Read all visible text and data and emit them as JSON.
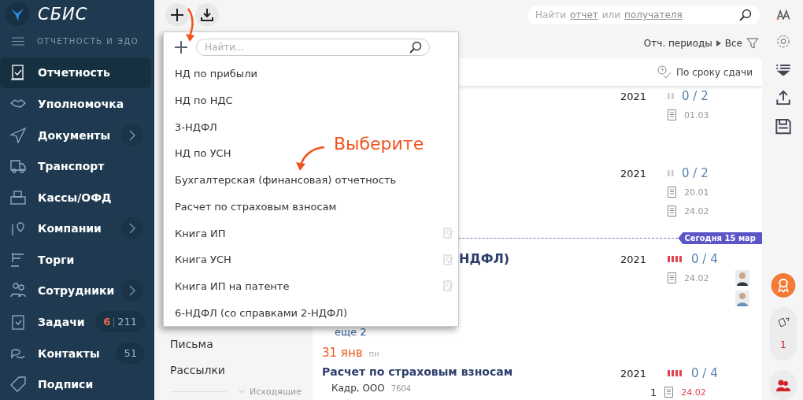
{
  "sidebar": {
    "logo": "СБИС",
    "section": "ОТЧЕТНОСТЬ И ЭДО",
    "items": [
      {
        "label": "Отчетность",
        "selected": true,
        "expandable": false
      },
      {
        "label": "Уполномочка",
        "selected": false,
        "expandable": false
      },
      {
        "label": "Документы",
        "selected": false,
        "expandable": true
      },
      {
        "label": "Транспорт",
        "selected": false,
        "expandable": false
      },
      {
        "label": "Кассы/ОФД",
        "selected": false,
        "expandable": false
      },
      {
        "label": "Компании",
        "selected": false,
        "expandable": true
      },
      {
        "label": "Торги",
        "selected": false,
        "expandable": false
      },
      {
        "label": "Сотрудники",
        "selected": false,
        "expandable": true
      },
      {
        "label": "Задачи",
        "selected": false,
        "expandable": false,
        "alert": "6",
        "count": "211"
      },
      {
        "label": "Контакты",
        "selected": false,
        "expandable": false,
        "count": "51"
      },
      {
        "label": "Подписи",
        "selected": false,
        "expandable": false
      }
    ]
  },
  "search": {
    "parts": [
      {
        "text": "Найти",
        "link": false
      },
      {
        "text": "отчет",
        "link": true
      },
      {
        "text": "или",
        "link": false
      },
      {
        "text": "получателя",
        "link": true
      }
    ]
  },
  "filter": {
    "label": "Отч. периоды",
    "value": "Все"
  },
  "dropdown": {
    "placeholder": "Найти...",
    "items": [
      {
        "label": "НД по прибыли",
        "editable": false
      },
      {
        "label": "НД по НДС",
        "editable": false
      },
      {
        "label": "3-НДФЛ",
        "editable": false
      },
      {
        "label": "НД по УСН",
        "editable": false
      },
      {
        "label": "Бухгалтерская (финансовая) отчетность",
        "editable": false
      },
      {
        "label": "Расчет по страховым взносам",
        "editable": false
      },
      {
        "label": "Книга ИП",
        "editable": true
      },
      {
        "label": "Книга УСН",
        "editable": true
      },
      {
        "label": "Книга ИП на патенте",
        "editable": true
      },
      {
        "label": "6-НДФЛ (со справками 2-НДФЛ)",
        "editable": false
      }
    ]
  },
  "annotation": "Выберите",
  "left_panel": {
    "items": [
      "Письма",
      "Рассылки"
    ],
    "footer": "Исходящие"
  },
  "card": {
    "sort": "По сроку сдачи",
    "records": [
      {
        "year": "2021",
        "color": "#c8c8c8",
        "progress": "0 / 2",
        "docs": [
          {
            "date": "01.03",
            "overdue": false
          }
        ]
      },
      {
        "year": "2021",
        "color": "#c8c8c8",
        "progress": "0 / 2",
        "docs": [
          {
            "date": "20.01",
            "overdue": false
          },
          {
            "date": "24.02",
            "overdue": false
          }
        ]
      }
    ],
    "today": "Сегодня 15 мар",
    "records_after": [
      {
        "title": "НДФЛ)",
        "more": "еще 2",
        "year": "2021",
        "color": "#e0444e",
        "progress": "0 / 4",
        "docs": [
          {
            "date": "24.02",
            "overdue": false
          }
        ],
        "avatars": [
          {
            "kind": "avatar"
          },
          {
            "kind": "avatar"
          }
        ]
      }
    ],
    "group": {
      "day": "31 янв",
      "weekday": "пн"
    },
    "records_group": [
      {
        "title": "Расчет по страховым взносам",
        "org": "Кадр, ООО",
        "code": "7604",
        "comments": "1",
        "year": "2021",
        "color": "#e0444e",
        "progress": "0 / 4",
        "docs": [
          {
            "date": "24.02",
            "overdue": true
          }
        ]
      }
    ]
  },
  "rail": {
    "count": "1"
  }
}
